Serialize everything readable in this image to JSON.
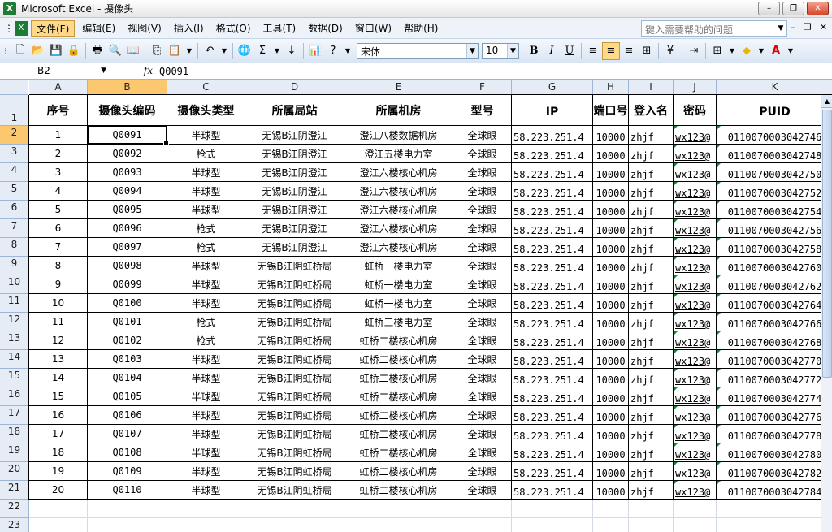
{
  "window": {
    "title": "Microsoft Excel - 摄像头"
  },
  "menu": [
    "文件(F)",
    "编辑(E)",
    "视图(V)",
    "插入(I)",
    "格式(O)",
    "工具(T)",
    "数据(D)",
    "窗口(W)",
    "帮助(H)"
  ],
  "help_placeholder": "键入需要帮助的问题",
  "toolbar": {
    "font_name": "宋体",
    "font_size": "10"
  },
  "formula_bar": {
    "name_box": "B2",
    "fx": "fx",
    "value": "Q0091"
  },
  "columns": [
    "A",
    "B",
    "C",
    "D",
    "E",
    "F",
    "G",
    "H",
    "I",
    "J",
    "K"
  ],
  "headers": [
    "序号",
    "摄像头编码",
    "摄像头类型",
    "所属局站",
    "所属机房",
    "型号",
    "IP",
    "端口号",
    "登入名",
    "密码",
    "PUID"
  ],
  "rows": [
    [
      "1",
      "Q0091",
      "半球型",
      "无锡B江阴澄江",
      "澄江八楼数据机房",
      "全球眼",
      "58.223.251.4",
      "10000",
      "zhjf",
      "wx123@",
      "0110070003042746"
    ],
    [
      "2",
      "Q0092",
      "枪式",
      "无锡B江阴澄江",
      "澄江五楼电力室",
      "全球眼",
      "58.223.251.4",
      "10000",
      "zhjf",
      "wx123@",
      "0110070003042748"
    ],
    [
      "3",
      "Q0093",
      "半球型",
      "无锡B江阴澄江",
      "澄江六楼核心机房",
      "全球眼",
      "58.223.251.4",
      "10000",
      "zhjf",
      "wx123@",
      "0110070003042750"
    ],
    [
      "4",
      "Q0094",
      "半球型",
      "无锡B江阴澄江",
      "澄江六楼核心机房",
      "全球眼",
      "58.223.251.4",
      "10000",
      "zhjf",
      "wx123@",
      "0110070003042752"
    ],
    [
      "5",
      "Q0095",
      "半球型",
      "无锡B江阴澄江",
      "澄江六楼核心机房",
      "全球眼",
      "58.223.251.4",
      "10000",
      "zhjf",
      "wx123@",
      "0110070003042754"
    ],
    [
      "6",
      "Q0096",
      "枪式",
      "无锡B江阴澄江",
      "澄江六楼核心机房",
      "全球眼",
      "58.223.251.4",
      "10000",
      "zhjf",
      "wx123@",
      "0110070003042756"
    ],
    [
      "7",
      "Q0097",
      "枪式",
      "无锡B江阴澄江",
      "澄江六楼核心机房",
      "全球眼",
      "58.223.251.4",
      "10000",
      "zhjf",
      "wx123@",
      "0110070003042758"
    ],
    [
      "8",
      "Q0098",
      "半球型",
      "无锡B江阴虹桥局",
      "虹桥一楼电力室",
      "全球眼",
      "58.223.251.4",
      "10000",
      "zhjf",
      "wx123@",
      "0110070003042760"
    ],
    [
      "9",
      "Q0099",
      "半球型",
      "无锡B江阴虹桥局",
      "虹桥一楼电力室",
      "全球眼",
      "58.223.251.4",
      "10000",
      "zhjf",
      "wx123@",
      "0110070003042762"
    ],
    [
      "10",
      "Q0100",
      "半球型",
      "无锡B江阴虹桥局",
      "虹桥一楼电力室",
      "全球眼",
      "58.223.251.4",
      "10000",
      "zhjf",
      "wx123@",
      "0110070003042764"
    ],
    [
      "11",
      "Q0101",
      "枪式",
      "无锡B江阴虹桥局",
      "虹桥三楼电力室",
      "全球眼",
      "58.223.251.4",
      "10000",
      "zhjf",
      "wx123@",
      "0110070003042766"
    ],
    [
      "12",
      "Q0102",
      "枪式",
      "无锡B江阴虹桥局",
      "虹桥二楼核心机房",
      "全球眼",
      "58.223.251.4",
      "10000",
      "zhjf",
      "wx123@",
      "0110070003042768"
    ],
    [
      "13",
      "Q0103",
      "半球型",
      "无锡B江阴虹桥局",
      "虹桥二楼核心机房",
      "全球眼",
      "58.223.251.4",
      "10000",
      "zhjf",
      "wx123@",
      "0110070003042770"
    ],
    [
      "14",
      "Q0104",
      "半球型",
      "无锡B江阴虹桥局",
      "虹桥二楼核心机房",
      "全球眼",
      "58.223.251.4",
      "10000",
      "zhjf",
      "wx123@",
      "0110070003042772"
    ],
    [
      "15",
      "Q0105",
      "半球型",
      "无锡B江阴虹桥局",
      "虹桥二楼核心机房",
      "全球眼",
      "58.223.251.4",
      "10000",
      "zhjf",
      "wx123@",
      "0110070003042774"
    ],
    [
      "16",
      "Q0106",
      "半球型",
      "无锡B江阴虹桥局",
      "虹桥二楼核心机房",
      "全球眼",
      "58.223.251.4",
      "10000",
      "zhjf",
      "wx123@",
      "0110070003042776"
    ],
    [
      "17",
      "Q0107",
      "半球型",
      "无锡B江阴虹桥局",
      "虹桥二楼核心机房",
      "全球眼",
      "58.223.251.4",
      "10000",
      "zhjf",
      "wx123@",
      "0110070003042778"
    ],
    [
      "18",
      "Q0108",
      "半球型",
      "无锡B江阴虹桥局",
      "虹桥二楼核心机房",
      "全球眼",
      "58.223.251.4",
      "10000",
      "zhjf",
      "wx123@",
      "0110070003042780"
    ],
    [
      "19",
      "Q0109",
      "半球型",
      "无锡B江阴虹桥局",
      "虹桥二楼核心机房",
      "全球眼",
      "58.223.251.4",
      "10000",
      "zhjf",
      "wx123@",
      "0110070003042782"
    ],
    [
      "20",
      "Q0110",
      "半球型",
      "无锡B江阴虹桥局",
      "虹桥二楼核心机房",
      "全球眼",
      "58.223.251.4",
      "10000",
      "zhjf",
      "wx123@",
      "0110070003042784"
    ]
  ],
  "row_numbers": [
    "1",
    "2",
    "3",
    "4",
    "5",
    "6",
    "7",
    "8",
    "9",
    "10",
    "11",
    "12",
    "13",
    "14",
    "15",
    "16",
    "17",
    "18",
    "19",
    "20",
    "21",
    "22",
    "23"
  ],
  "selected_cell": "B2"
}
